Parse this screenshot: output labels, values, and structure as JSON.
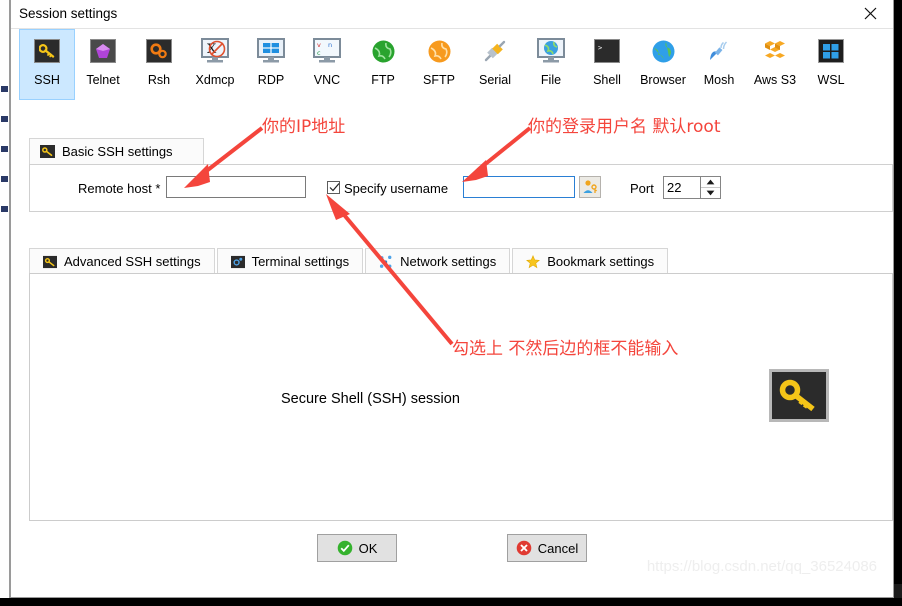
{
  "window": {
    "title": "Session settings",
    "close_icon": "close-icon"
  },
  "protocols": [
    {
      "label": "SSH",
      "icon": "ssh-key-icon",
      "selected": true
    },
    {
      "label": "Telnet",
      "icon": "telnet-gem-icon",
      "selected": false
    },
    {
      "label": "Rsh",
      "icon": "rsh-gears-icon",
      "selected": false
    },
    {
      "label": "Xdmcp",
      "icon": "xdmcp-monitor-icon",
      "selected": false
    },
    {
      "label": "RDP",
      "icon": "rdp-monitor-icon",
      "selected": false
    },
    {
      "label": "VNC",
      "icon": "vnc-monitor-icon",
      "selected": false
    },
    {
      "label": "FTP",
      "icon": "ftp-globe-icon",
      "selected": false
    },
    {
      "label": "SFTP",
      "icon": "sftp-globe-icon",
      "selected": false
    },
    {
      "label": "Serial",
      "icon": "serial-plug-icon",
      "selected": false
    },
    {
      "label": "File",
      "icon": "file-monitor-icon",
      "selected": false
    },
    {
      "label": "Shell",
      "icon": "shell-prompt-icon",
      "selected": false
    },
    {
      "label": "Browser",
      "icon": "browser-globe-icon",
      "selected": false
    },
    {
      "label": "Mosh",
      "icon": "mosh-dish-icon",
      "selected": false
    },
    {
      "label": "Aws S3",
      "icon": "aws-s3-cubes-icon",
      "selected": false
    },
    {
      "label": "WSL",
      "icon": "wsl-windows-icon",
      "selected": false
    }
  ],
  "basic_settings": {
    "tab_label": "Basic SSH settings",
    "tab_icon": "key-icon",
    "remote_host_label": "Remote host *",
    "remote_host_value": "",
    "remote_host_placeholder": "",
    "specify_username_label": "Specify username",
    "specify_username_checked": "checked",
    "username_value": "",
    "username_placeholder": "",
    "user_browse_icon": "user-key-icon",
    "port_label": "Port",
    "port_value": "22",
    "spin_up_icon": "caret-up-icon",
    "spin_down_icon": "caret-down-icon"
  },
  "sub_tabs": [
    {
      "label": "Advanced SSH settings",
      "icon": "key-icon"
    },
    {
      "label": "Terminal settings",
      "icon": "terminal-icon"
    },
    {
      "label": "Network settings",
      "icon": "network-icon"
    },
    {
      "label": "Bookmark settings",
      "icon": "star-icon"
    }
  ],
  "session_panel": {
    "caption": "Secure Shell (SSH) session",
    "graphic_icon": "large-key-icon"
  },
  "footer": {
    "ok_label": "OK",
    "ok_icon": "green-check-icon",
    "cancel_label": "Cancel",
    "cancel_icon": "red-x-icon"
  },
  "annotations": [
    {
      "id": "ip-note",
      "text": "你的IP地址"
    },
    {
      "id": "username-note",
      "text": "你的登录用户名 默认root"
    },
    {
      "id": "checkbox-note",
      "text": "勾选上 不然后边的框不能输入"
    }
  ],
  "watermark": "https://blog.csdn.net/qq_36524086",
  "colors": {
    "accent_selected": "#cce8ff",
    "annotation_red": "#f4453c",
    "focus_border": "#2a7fd4",
    "ok_green": "#35b22e",
    "cancel_red": "#e03a32"
  }
}
